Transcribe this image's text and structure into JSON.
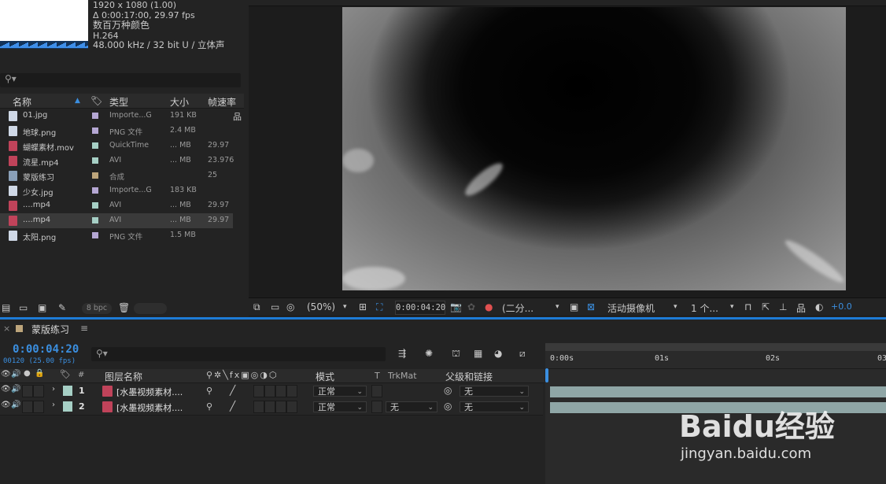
{
  "project": {
    "selected_item_info": {
      "resolution": "1920 x 1080 (1.00)",
      "duration": "Δ 0:00:17:00, 29.97 fps",
      "colors": "数百万种颜色",
      "codec": "H.264",
      "audio": "48.000 kHz / 32 bit U / 立体声"
    },
    "columns": {
      "name": "名称",
      "type": "类型",
      "size": "大小",
      "fps": "帧速率"
    },
    "items": [
      {
        "name": "01.jpg",
        "type": "Importe...G",
        "size": "191 KB",
        "fps": "",
        "icon": "image-file-icon",
        "label_color": "#b5a7d3"
      },
      {
        "name": "地球.png",
        "type": "PNG 文件",
        "size": "2.4 MB",
        "fps": "",
        "icon": "image-file-icon",
        "label_color": "#b5a7d3"
      },
      {
        "name": "蝴蝶素材.mov",
        "type": "QuickTime",
        "size": "... MB",
        "fps": "29.97",
        "icon": "video-file-icon",
        "label_color": "#a6cfc5"
      },
      {
        "name": "流星.mp4",
        "type": "AVI",
        "size": "... MB",
        "fps": "23.976",
        "icon": "video-file-icon",
        "label_color": "#a6cfc5"
      },
      {
        "name": "蒙版练习",
        "type": "合成",
        "size": "",
        "fps": "25",
        "icon": "composition-icon",
        "label_color": "#bda57b"
      },
      {
        "name": "少女.jpg",
        "type": "Importe...G",
        "size": "183 KB",
        "fps": "",
        "icon": "image-file-icon",
        "label_color": "#b5a7d3"
      },
      {
        "name": "....mp4",
        "type": "AVI",
        "size": "... MB",
        "fps": "29.97",
        "icon": "video-file-icon",
        "label_color": "#a6cfc5"
      },
      {
        "name": "....mp4",
        "type": "AVI",
        "size": "... MB",
        "fps": "29.97",
        "icon": "video-file-icon",
        "label_color": "#a6cfc5",
        "selected": true
      },
      {
        "name": "太阳.png",
        "type": "PNG 文件",
        "size": "1.5 MB",
        "fps": "",
        "icon": "image-file-icon",
        "label_color": "#b5a7d3"
      }
    ],
    "footer": {
      "bpc": "8 bpc"
    }
  },
  "viewer": {
    "zoom": "(50%)",
    "timecode": "0:00:04:20",
    "resolution": "(二分...",
    "camera": "活动摄像机",
    "views": "1 个...",
    "exposure": "+0.0"
  },
  "timeline": {
    "comp_name": "蒙版练习",
    "timecode": "0:00:04:20",
    "frame_info": "00120 (25.00 fps)",
    "columns": {
      "number": "#",
      "layer_name": "图层名称",
      "mode": "模式",
      "t": "T",
      "trkmat": "TrkMat",
      "parent": "父级和链接"
    },
    "ruler": [
      "0:00s",
      "01s",
      "02s",
      "03"
    ],
    "layers": [
      {
        "number": "1",
        "name": "[水墨视频素材....",
        "mode": "正常",
        "trkmat": "",
        "parent": "无"
      },
      {
        "number": "2",
        "name": "[水墨视频素材....",
        "mode": "正常",
        "trkmat": "无",
        "parent": "无"
      }
    ]
  },
  "watermark": {
    "brand": "Baidu经验",
    "url": "jingyan.baidu.com"
  }
}
